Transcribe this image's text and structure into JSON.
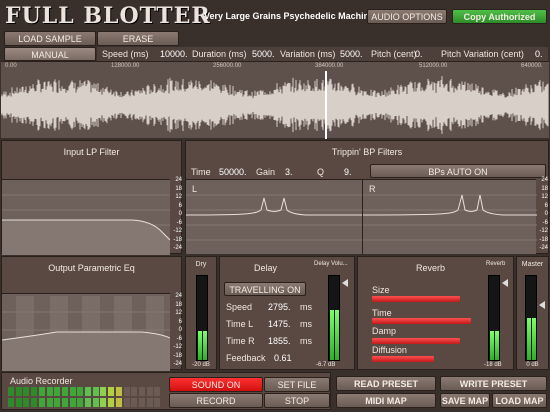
{
  "app": {
    "logo": "FULL BLOTTER",
    "subtitle": "Very Large Grains Psychedelic Machine"
  },
  "header": {
    "audio_options": "AUDIO OPTIONS",
    "copy_authorized": "Copy Authorized"
  },
  "sample": {
    "load": "LOAD SAMPLE",
    "erase": "ERASE",
    "mode": "MANUAL",
    "speed_label": "Speed (ms)",
    "speed_value": "10000.",
    "duration_label": "Duration (ms)",
    "duration_value": "5000.",
    "variation_label": "Variation (ms)",
    "variation_value": "5000.",
    "pitch_label": "Pitch (cent)",
    "pitch_value": "0.",
    "pitch_var_label": "Pitch Variation (cent)",
    "pitch_var_value": "0.",
    "ruler": [
      "0.00",
      "128000.00",
      "256000.00",
      "384000.00",
      "512000.00",
      "640000."
    ]
  },
  "scales": {
    "filter": [
      "24",
      "18",
      "12",
      "6",
      "0",
      "-6",
      "-12",
      "-18",
      "-24"
    ],
    "short": [
      "24",
      "18",
      "12",
      "6",
      "-6",
      "-12",
      "-18",
      "-24"
    ]
  },
  "input_lp": {
    "title": "Input LP Filter"
  },
  "bp": {
    "title": "Trippin' BP Filters",
    "time_label": "Time",
    "time_value": "50000.",
    "gain_label": "Gain",
    "gain_value": "3.",
    "q_label": "Q",
    "q_value": "9.",
    "auto_button": "BPs AUTO ON",
    "left": "L",
    "right": "R"
  },
  "output_eq": {
    "title": "Output Parametric Eq"
  },
  "dry": {
    "label": "Dry",
    "value": "-20 dB",
    "level": 0.35
  },
  "delay": {
    "title": "Delay",
    "travel_button": "TRAVELLING ON",
    "speed_label": "Speed",
    "speed_value": "2795.",
    "speed_unit": "ms",
    "time_l_label": "Time L",
    "time_l_value": "1475.",
    "time_l_unit": "ms",
    "time_r_label": "Time R",
    "time_r_value": "1855.",
    "time_r_unit": "ms",
    "feedback_label": "Feedback",
    "feedback_value": "0.61",
    "volume_label": "Delay Volu...",
    "volume_value": "-6.7 dB",
    "volume_level": 0.6
  },
  "reverb": {
    "title": "Reverb",
    "size_label": "Size",
    "size_level": 0.85,
    "time_label": "Time",
    "time_level": 0.95,
    "damp_label": "Damp",
    "damp_level": 0.85,
    "diffusion_label": "Diffusion",
    "diffusion_level": 0.6,
    "out_label": "Reverb",
    "out_value": "-18 dB",
    "out_level": 0.35
  },
  "master": {
    "label": "Master",
    "value": "0 dB",
    "level": 0.5
  },
  "recorder": {
    "title": "Audio Recorder",
    "sound_on": "SOUND ON",
    "set_file": "SET FILE",
    "record": "RECORD",
    "stop": "STOP"
  },
  "presets": {
    "read": "READ PRESET",
    "write": "WRITE PRESET",
    "midi_map": "MIDI MAP",
    "save_map": "SAVE MAP",
    "load_map": "LOAD MAP"
  },
  "colors": {
    "accent_green": "#3fa63a",
    "accent_red": "#e02020",
    "meter_green": "#5fe04f"
  }
}
